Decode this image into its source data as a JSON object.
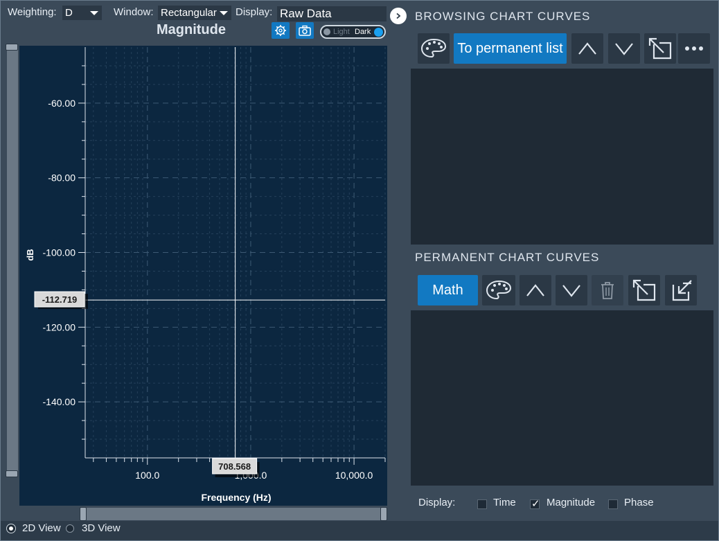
{
  "header": {
    "weighting_label": "Weighting:",
    "weighting_value": "D",
    "window_label": "Window:",
    "window_value": "Rectangular",
    "display_label": "Display:",
    "display_value": "Raw Data",
    "plot_title": "Magnitude",
    "toggle_light": "Light",
    "toggle_dark": "Dark"
  },
  "chart_data": {
    "type": "line",
    "title": "Magnitude",
    "xlabel": "Frequency (Hz)",
    "ylabel": "dB",
    "x_scale": "log",
    "xlim": [
      25,
      20000
    ],
    "ylim": [
      -155,
      -45
    ],
    "y_ticks": [
      -60,
      -80,
      -100,
      -120,
      -140
    ],
    "y_tick_labels": [
      "-60.00",
      "-80.00",
      "-100.00",
      "-120.00",
      "-140.00"
    ],
    "x_ticks": [
      100,
      1000,
      10000
    ],
    "x_tick_labels": [
      "100.0",
      "1,000.0",
      "10,000.0"
    ],
    "grid": true,
    "series": [],
    "cursor": {
      "x": 708.568,
      "y": -112.719,
      "x_label": "708.568",
      "y_label": "-112.719"
    }
  },
  "browsing": {
    "title": "BROWSING CHART CURVES",
    "to_permanent_label": "To permanent list"
  },
  "permanent": {
    "title": "PERMANENT CHART CURVES",
    "math_label": "Math"
  },
  "display_options": {
    "label": "Display:",
    "options": [
      {
        "label": "Time",
        "checked": false
      },
      {
        "label": "Magnitude",
        "checked": true
      },
      {
        "label": "Phase",
        "checked": false
      }
    ]
  },
  "view_modes": [
    {
      "label": "2D View",
      "selected": true
    },
    {
      "label": "3D View",
      "selected": false
    }
  ],
  "colors": {
    "accent": "#1279c2",
    "chart_bg": "#0c2740",
    "panel_bg": "#3b4a59",
    "list_bg": "#1f2a35"
  }
}
